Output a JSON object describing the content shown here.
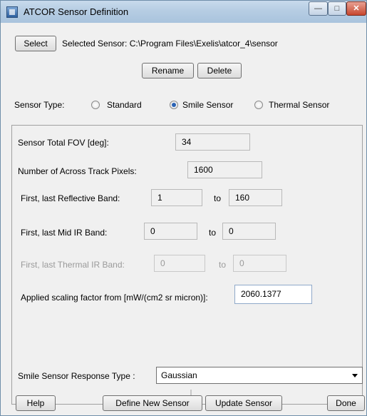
{
  "window": {
    "title": "ATCOR Sensor Definition"
  },
  "sensor": {
    "select_label": "Select",
    "selected_text": "Selected Sensor: C:\\Program Files\\Exelis\\atcor_4\\sensor"
  },
  "actions": {
    "rename_label": "Rename",
    "delete_label": "Delete"
  },
  "sensor_type": {
    "label": "Sensor Type:",
    "options": [
      "Standard",
      "Smile Sensor",
      "Thermal Sensor"
    ],
    "selected": "Smile Sensor"
  },
  "params": {
    "fov_label": "Sensor Total FOV [deg]:",
    "fov_value": "34",
    "pixels_label": "Number of Across Track Pixels:",
    "pixels_value": "1600",
    "reflective_label": "First, last Reflective Band:",
    "reflective_first": "1",
    "reflective_last": "160",
    "midir_label": "First, last Mid IR Band:",
    "midir_first": "0",
    "midir_last": "0",
    "thermal_label": "First, last Thermal IR Band:",
    "thermal_first": "0",
    "thermal_last": "0",
    "to_label": "to",
    "scaling_label": "Applied scaling factor from [mW/(cm2 sr micron)]:",
    "scaling_value": "2060.1377"
  },
  "response": {
    "label": "Smile Sensor Response Type :",
    "selected": "Gaussian"
  },
  "footer": {
    "help_label": "Help",
    "define_label": "Define New Sensor",
    "update_label": "Update Sensor",
    "done_label": "Done"
  }
}
